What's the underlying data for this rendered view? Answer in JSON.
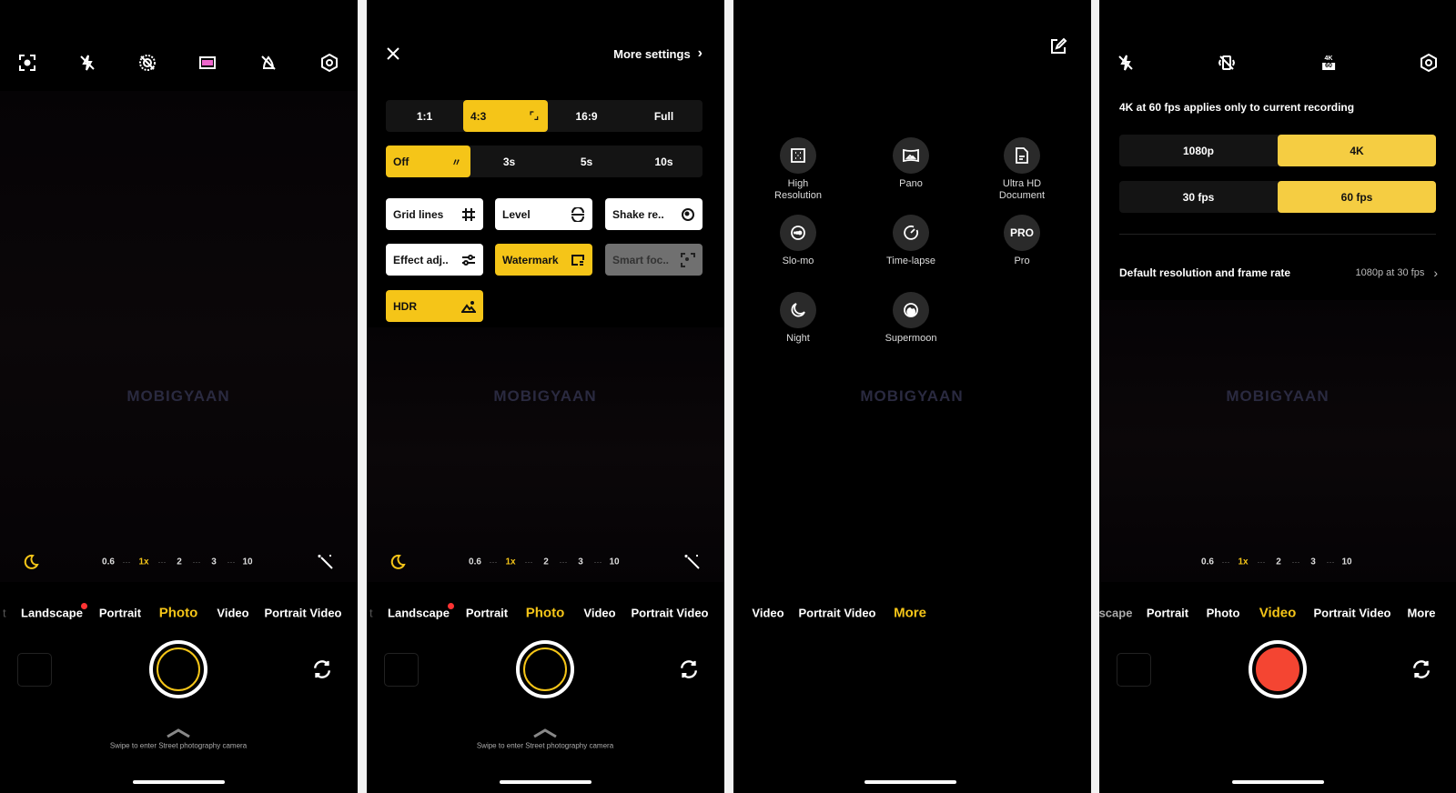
{
  "colors": {
    "accent": "#f5c518",
    "record": "#f44532",
    "background": "#000000"
  },
  "watermark": "MOBIGYAAN",
  "zoom_levels": [
    "0.6",
    "1x",
    "2",
    "3",
    "10"
  ],
  "swipe_hint": "Swipe to enter Street photography camera",
  "panel1": {
    "top_icons": [
      "focus-icon",
      "flash-off-icon",
      "live-photo-off-icon",
      "filter-icon",
      "ai-scene-off-icon",
      "settings-icon"
    ],
    "modes": [
      "Landscape",
      "Portrait",
      "Photo",
      "Video",
      "Portrait Video"
    ],
    "active_mode": "Photo"
  },
  "panel2": {
    "more_settings": "More settings",
    "aspect": [
      "1:1",
      "4:3",
      "16:9",
      "Full"
    ],
    "aspect_selected": "4:3",
    "timer": [
      "Off",
      "3s",
      "5s",
      "10s"
    ],
    "timer_selected": "Off",
    "toggles": [
      {
        "label": "Grid lines",
        "icon": "grid-icon",
        "state": "on"
      },
      {
        "label": "Level",
        "icon": "level-icon",
        "state": "on"
      },
      {
        "label": "Shake re..",
        "icon": "shake-reduction-icon",
        "state": "on"
      },
      {
        "label": "Effect adj..",
        "icon": "sliders-icon",
        "state": "on"
      },
      {
        "label": "Watermark",
        "icon": "watermark-icon",
        "state": "active"
      },
      {
        "label": "Smart foc..",
        "icon": "smart-focus-icon",
        "state": "disabled"
      },
      {
        "label": "HDR",
        "icon": "hdr-icon",
        "state": "active"
      }
    ],
    "modes": [
      "Landscape",
      "Portrait",
      "Photo",
      "Video",
      "Portrait Video"
    ],
    "active_mode": "Photo"
  },
  "panel3": {
    "more_modes": [
      {
        "label": "High\nResolution",
        "icon": "high-resolution-icon"
      },
      {
        "label": "Pano",
        "icon": "pano-icon"
      },
      {
        "label": "Ultra HD\nDocument",
        "icon": "document-icon"
      },
      {
        "label": "Slo-mo",
        "icon": "slo-mo-icon"
      },
      {
        "label": "Time-lapse",
        "icon": "time-lapse-icon"
      },
      {
        "label": "Pro",
        "icon": "pro-icon",
        "icon_text": "PRO"
      },
      {
        "label": "Night",
        "icon": "night-icon"
      },
      {
        "label": "Supermoon",
        "icon": "supermoon-icon"
      }
    ],
    "modes": [
      "Video",
      "Portrait Video",
      "More"
    ],
    "active_mode": "More"
  },
  "panel4": {
    "badge_top": "4K",
    "badge_bottom": "60",
    "notice": "4K at 60 fps applies only to current recording",
    "resolution": [
      "1080p",
      "4K"
    ],
    "resolution_selected": "4K",
    "fps": [
      "30 fps",
      "60 fps"
    ],
    "fps_selected": "60 fps",
    "default_label": "Default resolution and frame rate",
    "default_value": "1080p at 30 fps",
    "modes": [
      "scape",
      "Portrait",
      "Photo",
      "Video",
      "Portrait Video",
      "More"
    ],
    "active_mode": "Video"
  }
}
